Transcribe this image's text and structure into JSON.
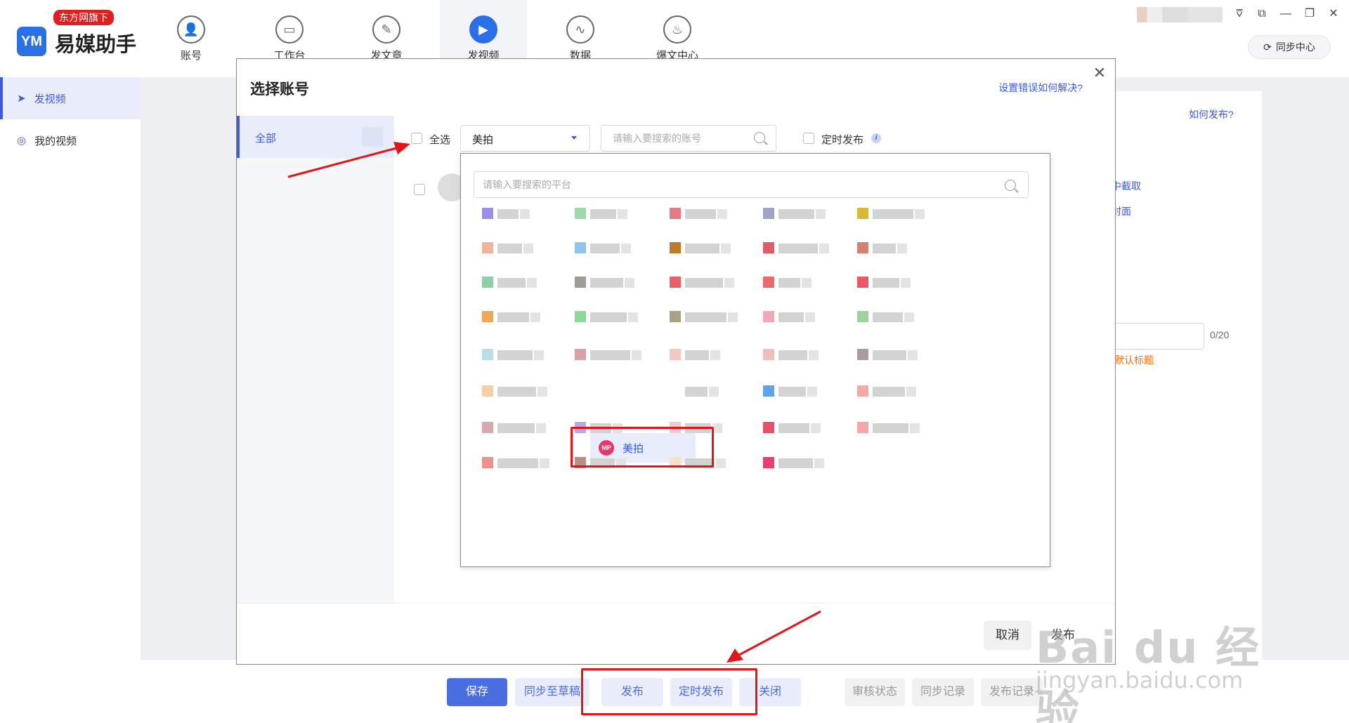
{
  "app": {
    "brand": "易媒助手",
    "badge": "东方网旗下",
    "logo_mark": "YM"
  },
  "nav": [
    {
      "label": "账号",
      "icon": "user-icon",
      "glyph": "👤"
    },
    {
      "label": "工作台",
      "icon": "monitor-icon",
      "glyph": "▭"
    },
    {
      "label": "发文章",
      "icon": "feather-icon",
      "glyph": "✎"
    },
    {
      "label": "发视频",
      "icon": "play-icon",
      "glyph": "▶",
      "active": true
    },
    {
      "label": "数据",
      "icon": "chart-icon",
      "glyph": "∿"
    },
    {
      "label": "爆文中心",
      "icon": "flame-icon",
      "glyph": "♨"
    }
  ],
  "window": {
    "sync_label": "同步中心",
    "sync_glyph": "⟳",
    "glyph_menu": "⩢",
    "glyph_external": "⧉",
    "glyph_min": "—",
    "glyph_max": "❐",
    "glyph_close": "✕"
  },
  "sidebar": {
    "items": [
      {
        "label": "发视频",
        "glyph": "➤",
        "active": true
      },
      {
        "label": "我的视频",
        "glyph": "◎"
      }
    ]
  },
  "background": {
    "how_to_publish": "如何发布?",
    "capture_link": "中截取",
    "cover_link": "封面",
    "title_count": "0/20",
    "default_title": "默认标题"
  },
  "modal": {
    "title": "选择账号",
    "help_link": "设置错误如何解决?",
    "close_glyph": "✕",
    "groups": [
      {
        "label": "全部"
      }
    ],
    "select_all_label": "全选",
    "platform_select_value": "美拍",
    "account_search_placeholder": "请输入要搜索的账号",
    "scheduled_label": "定时发布",
    "info_glyph": "i",
    "cancel_label": "取消",
    "publish_label": "发布"
  },
  "dropdown": {
    "search_placeholder": "请输入要搜索的平台",
    "selected_platform": {
      "label": "美拍",
      "logo_text": "MP"
    }
  },
  "toolbar": {
    "save": "保存",
    "sync_draft": "同步至草稿",
    "publish": "发布",
    "scheduled_publish": "定时发布",
    "close": "关闭",
    "review_status": "审核状态",
    "sync_records": "同步记录",
    "publish_records": "发布记录"
  },
  "colors": {
    "accent": "#3d5bd6",
    "primary_button": "#4a6ee0",
    "annotation_red": "#e0161b",
    "brand_badge": "#e02020",
    "meipai": "#e8386b"
  },
  "watermark": {
    "main": "Bai du 经验",
    "sub": "jingyan.baidu.com"
  }
}
